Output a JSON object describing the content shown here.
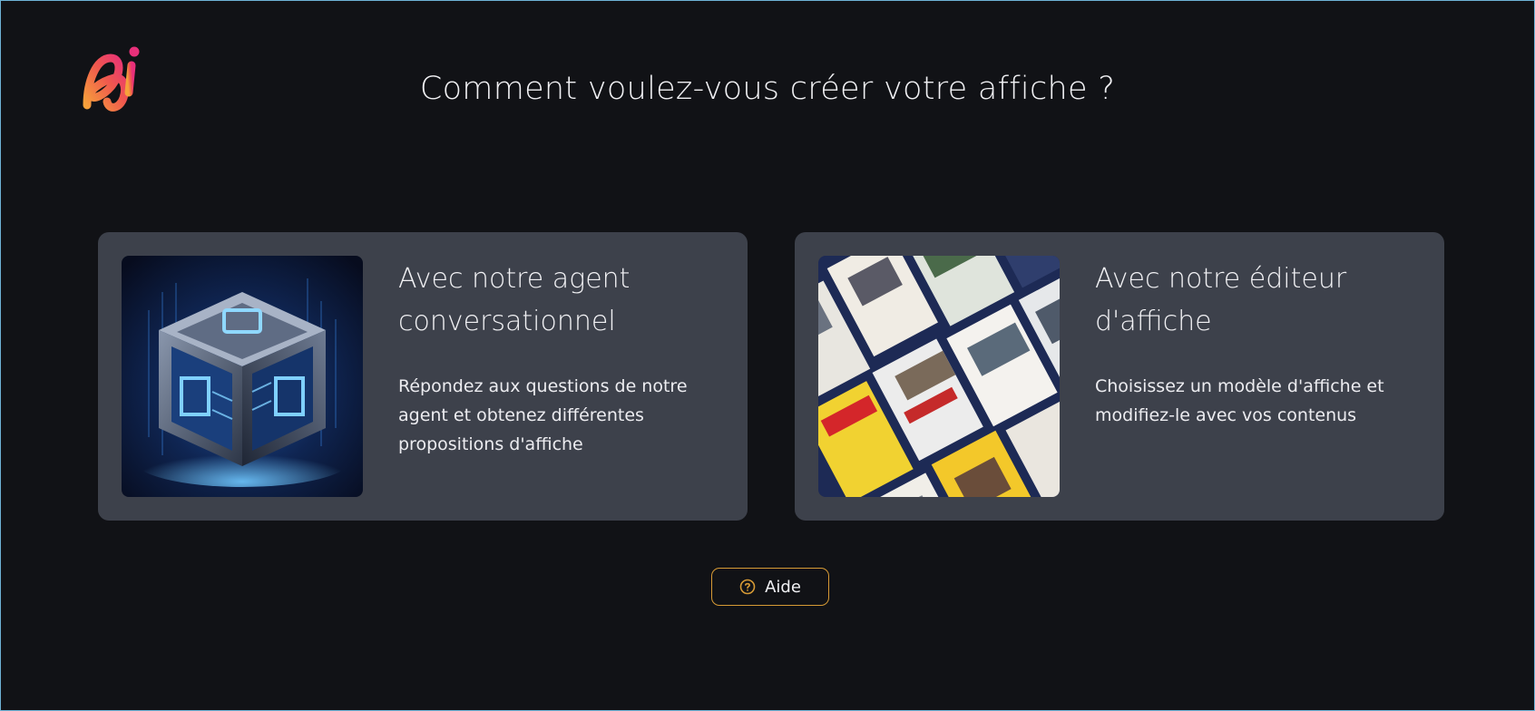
{
  "header": {
    "logo_icon": "app-logo-icon",
    "title": "Comment voulez-vous créer votre affiche ?"
  },
  "options": [
    {
      "title": "Avec notre agent\nconversationnel",
      "description": "Répondez aux questions de notre\nagent et obtenez différentes\npropositions d'affiche",
      "image": "glowing-cube-illustration"
    },
    {
      "title": "Avec notre éditeur\nd'affiche",
      "description": "Choisissez un modèle d'affiche et\nmodifiez-le avec vos contenus",
      "image": "poster-collage-illustration"
    }
  ],
  "help_button": {
    "label": "Aide",
    "icon": "question-circle-icon"
  },
  "colors": {
    "background": "#111216",
    "card": "#3d414b",
    "accent": "#d69a35",
    "frame": "#6fb3d6"
  }
}
